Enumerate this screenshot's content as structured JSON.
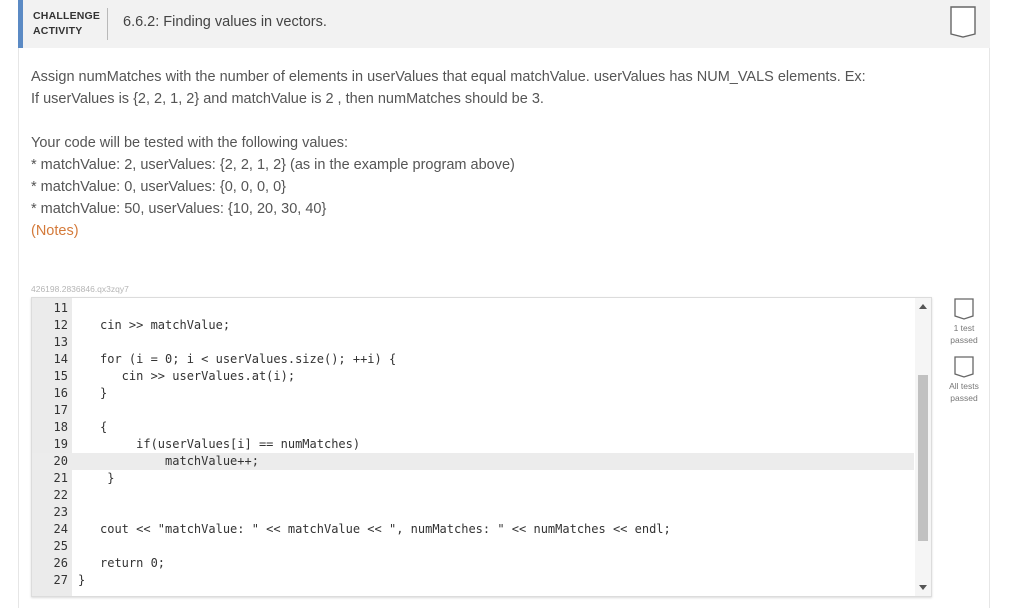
{
  "header": {
    "badge_line1": "CHALLENGE",
    "badge_line2": "ACTIVITY",
    "title": "6.6.2: Finding values in vectors."
  },
  "description": {
    "line1": "Assign numMatches with the number of elements in userValues that equal matchValue. userValues has NUM_VALS elements. Ex:",
    "line2": "If userValues is {2, 2, 1, 2} and matchValue is 2 , then numMatches should be 3."
  },
  "tests": {
    "intro": "Your code will be tested with the following values:",
    "cases": [
      "* matchValue: 2, userValues: {2, 2, 1, 2} (as in the example program above)",
      "* matchValue: 0, userValues: {0, 0, 0, 0}",
      "* matchValue: 50, userValues: {10, 20, 30, 40}"
    ],
    "notes": "(Notes)"
  },
  "session_id": "426198.2836846.qx3zqy7",
  "editor": {
    "lines": [
      {
        "n": "11",
        "code": ""
      },
      {
        "n": "12",
        "code": "cin >> matchValue;"
      },
      {
        "n": "13",
        "code": ""
      },
      {
        "n": "14",
        "code": "for (i = 0; i < userValues.size(); ++i) {"
      },
      {
        "n": "15",
        "code": "   cin >> userValues.at(i);"
      },
      {
        "n": "16",
        "code": "}"
      },
      {
        "n": "17",
        "code": ""
      },
      {
        "n": "18",
        "code": "{"
      },
      {
        "n": "19",
        "code": "     if(userValues[i] == numMatches)"
      },
      {
        "n": "20",
        "code": "         matchValue++;"
      },
      {
        "n": "21",
        "code": " }"
      },
      {
        "n": "22",
        "code": ""
      },
      {
        "n": "23",
        "code": ""
      },
      {
        "n": "24",
        "code": "cout << \"matchValue: \" << matchValue << \", numMatches: \" << numMatches << endl;"
      },
      {
        "n": "25",
        "code": ""
      },
      {
        "n": "26",
        "code": "return 0;"
      },
      {
        "n": "27",
        "code": "}"
      }
    ],
    "active_line": "20",
    "scroll_fraction": 0.62
  },
  "status": {
    "test1": "1 test passed",
    "all": "All tests passed"
  },
  "colors": {
    "accent": "#5b8ac4",
    "notes": "#d47a3a"
  }
}
